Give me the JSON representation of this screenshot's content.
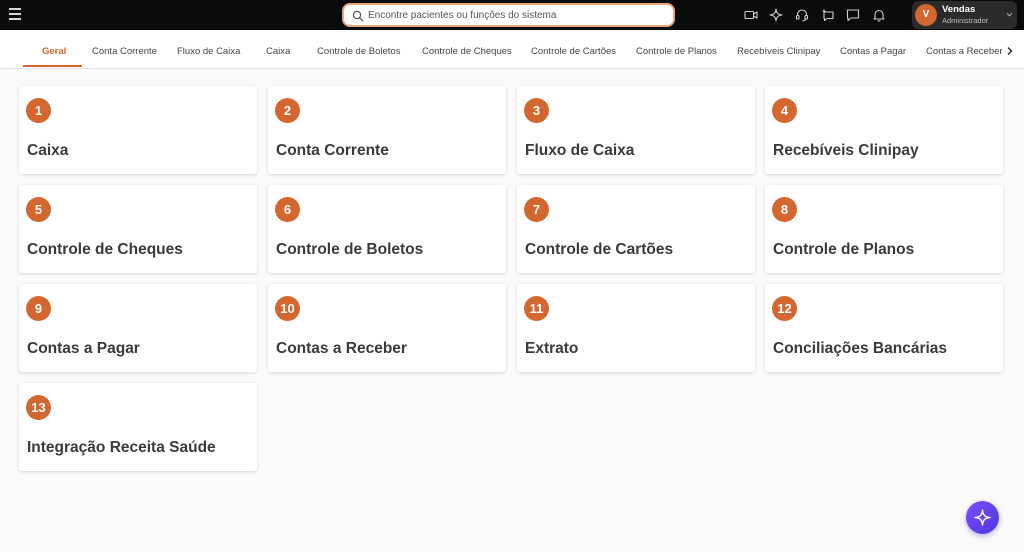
{
  "header": {
    "search_placeholder": "Encontre pacientes ou funções do sistema",
    "icons": [
      "menu-icon",
      "video-icon",
      "sparkle-icon",
      "headset-icon",
      "ai-chat-icon",
      "chat-icon",
      "bell-icon"
    ],
    "user": {
      "initial": "V",
      "name": "Vendas",
      "role": "Administrador"
    }
  },
  "tabs": [
    {
      "label": "Geral",
      "active": true
    },
    {
      "label": "Conta Corrente",
      "active": false
    },
    {
      "label": "Fluxo de Caixa",
      "active": false
    },
    {
      "label": "Caixa",
      "active": false
    },
    {
      "label": "Controle de Boletos",
      "active": false
    },
    {
      "label": "Controle de Cheques",
      "active": false
    },
    {
      "label": "Controle de Cartões",
      "active": false
    },
    {
      "label": "Controle de Planos",
      "active": false
    },
    {
      "label": "Recebíveis Clinipay",
      "active": false
    },
    {
      "label": "Contas a Pagar",
      "active": false
    },
    {
      "label": "Contas a Receber",
      "active": false
    }
  ],
  "cards": [
    {
      "number": "1",
      "title": "Caixa"
    },
    {
      "number": "2",
      "title": "Conta Corrente"
    },
    {
      "number": "3",
      "title": "Fluxo de Caixa"
    },
    {
      "number": "4",
      "title": "Recebíveis Clinipay"
    },
    {
      "number": "5",
      "title": "Controle de Cheques"
    },
    {
      "number": "6",
      "title": "Controle de Boletos"
    },
    {
      "number": "7",
      "title": "Controle de Cartões"
    },
    {
      "number": "8",
      "title": "Controle de Planos"
    },
    {
      "number": "9",
      "title": "Contas a Pagar"
    },
    {
      "number": "10",
      "title": "Contas a Receber"
    },
    {
      "number": "11",
      "title": "Extrato"
    },
    {
      "number": "12",
      "title": "Conciliações Bancárias"
    },
    {
      "number": "13",
      "title": "Integração Receita Saúde"
    }
  ],
  "colors": {
    "accent": "#d4662f",
    "topbar": "#0b0b0b",
    "fab": "#5b3ef0"
  }
}
